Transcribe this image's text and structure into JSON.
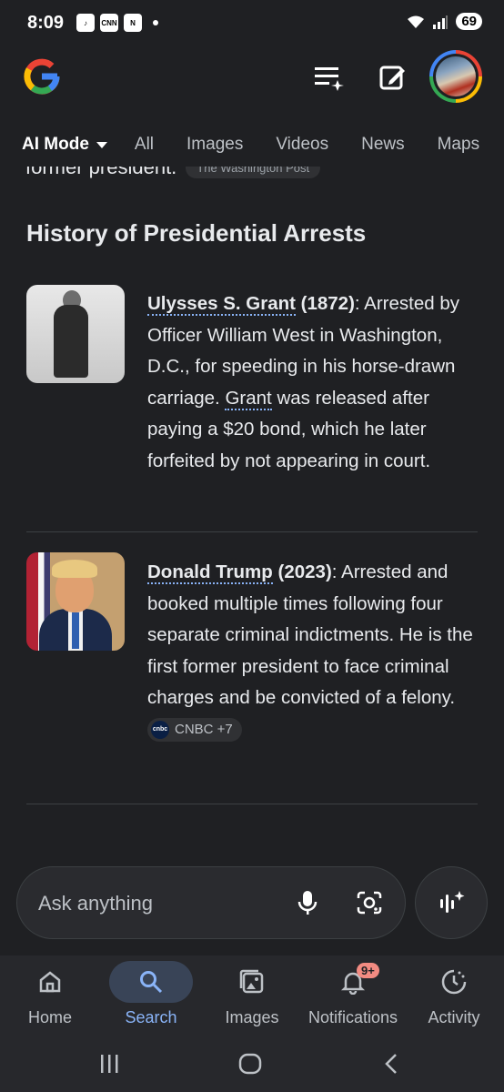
{
  "status_bar": {
    "time": "8:09",
    "battery": "69",
    "app_icons": [
      "tiktok-icon",
      "cnn-icon",
      "news-app-icon"
    ],
    "cnn_label": "CNN"
  },
  "header": {
    "logo": "google-g-logo",
    "icons": [
      "search-history-icon",
      "edit-icon",
      "profile-avatar"
    ]
  },
  "tabs": {
    "ai_mode": "AI Mode",
    "all": "All",
    "images": "Images",
    "videos": "Videos",
    "news": "News",
    "maps": "Maps"
  },
  "content": {
    "cutoff_text": "former president.",
    "cutoff_source": "The Washington Post",
    "section_title": "History of Presidential Arrests",
    "entries": [
      {
        "name": "Ulysses S. Grant",
        "year": " (1872)",
        "text_a": ": Arrested by Officer William West in Washington, D.C., for speeding in his horse-drawn carriage. ",
        "link": "Grant",
        "text_b": " was released after paying a $20 bond, which he later forfeited by not appearing in court."
      },
      {
        "name": "Donald Trump",
        "year": " (2023)",
        "text_a": ": Arrested and booked multiple times following four separate criminal indictments. He is the first former president to face criminal charges and be convicted of a felony. ",
        "citation": "CNBC +7",
        "citation_logo": "cnbc"
      }
    ]
  },
  "ask_bar": {
    "placeholder": "Ask anything"
  },
  "bottom_nav": [
    {
      "label": "Home",
      "icon": "home-icon"
    },
    {
      "label": "Search",
      "icon": "search-icon",
      "active": true
    },
    {
      "label": "Images",
      "icon": "images-icon"
    },
    {
      "label": "Notifications",
      "icon": "bell-icon",
      "badge": "9+"
    },
    {
      "label": "Activity",
      "icon": "activity-icon"
    }
  ],
  "colors": {
    "background": "#1f2023",
    "accent": "#8ab4f8",
    "nav_active": "#394457",
    "badge": "#f28b82"
  }
}
